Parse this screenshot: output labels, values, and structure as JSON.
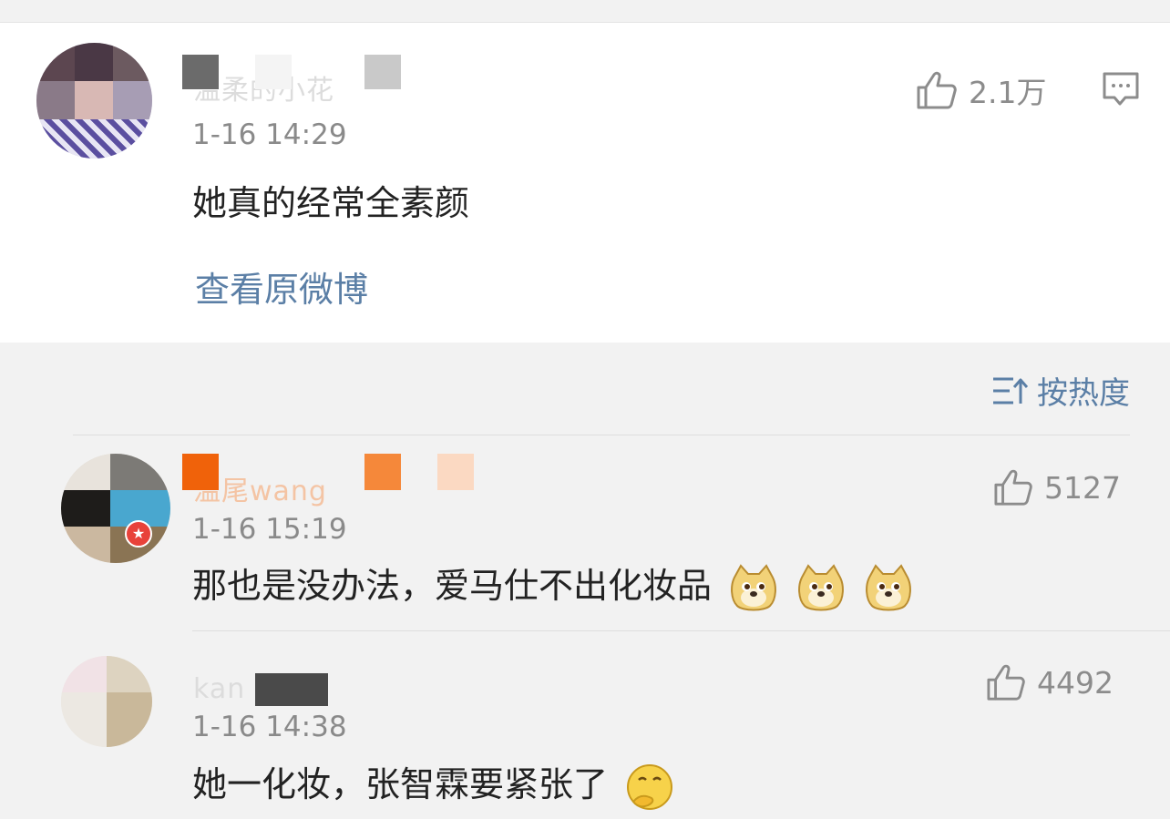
{
  "main_comment": {
    "username_partial": "温柔的小花",
    "time": "1-16 14:29",
    "text": "她真的经常全素颜",
    "likes": "2.1万",
    "link": "查看原微博"
  },
  "sort": {
    "label": "按热度"
  },
  "replies": [
    {
      "username_partial": "温尾wang",
      "time": "1-16 15:19",
      "text": "那也是没办法，爱马仕不出化妆品",
      "likes": "5127",
      "emoji": [
        "doge-emoji",
        "doge-emoji",
        "doge-emoji"
      ]
    },
    {
      "username_partial": "kan",
      "time": "1-16 14:38",
      "text": "她一化妆，张智霖要紧张了",
      "likes": "4492",
      "emoji": [
        "thinking-emoji"
      ]
    }
  ],
  "colors": {
    "link": "#5b7fa6",
    "meta": "#8a8a8a",
    "text": "#222222",
    "reply_bg": "#f2f2f2"
  }
}
